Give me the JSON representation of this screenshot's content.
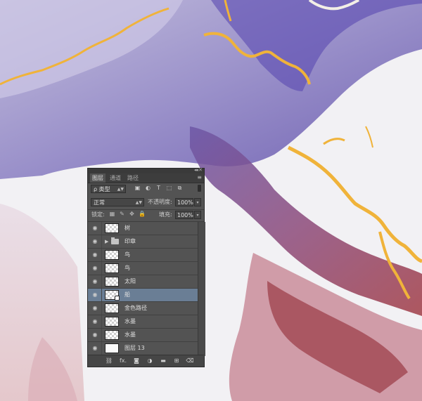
{
  "panel": {
    "tabs": [
      {
        "label": "图层",
        "active": true
      },
      {
        "label": "通道",
        "active": false
      },
      {
        "label": "路径",
        "active": false
      }
    ],
    "filter_kind": "ρ 类型",
    "blend_mode": "正常",
    "opacity_label": "不透明度:",
    "opacity_value": "100%",
    "lock_label": "锁定:",
    "fill_label": "填充:",
    "fill_value": "100%",
    "layers": [
      {
        "name": "树",
        "type": "raster",
        "visible": true,
        "selected": false
      },
      {
        "name": "印章",
        "type": "group",
        "visible": true,
        "selected": false
      },
      {
        "name": "鸟",
        "type": "raster",
        "visible": true,
        "selected": false
      },
      {
        "name": "鸟",
        "type": "raster",
        "visible": true,
        "selected": false
      },
      {
        "name": "太阳",
        "type": "raster",
        "visible": true,
        "selected": false
      },
      {
        "name": "船",
        "type": "smart-object",
        "visible": true,
        "selected": true
      },
      {
        "name": "金色路径",
        "type": "raster",
        "visible": true,
        "selected": false
      },
      {
        "name": "水墨",
        "type": "raster",
        "visible": true,
        "selected": false
      },
      {
        "name": "水墨",
        "type": "raster",
        "visible": true,
        "selected": false
      },
      {
        "name": "图层 13",
        "type": "raster-white",
        "visible": true,
        "selected": false
      }
    ],
    "bottom_icons": [
      "link-icon",
      "fx-icon",
      "mask-icon",
      "adjustment-icon",
      "folder-icon",
      "new-layer-icon",
      "trash-icon"
    ],
    "fx_label": "fx."
  },
  "colors": {
    "selected_row": "#6a7e95",
    "panel_bg": "#535353",
    "gold": "#f0b33a",
    "ink_purple": "#4a3f9a",
    "ink_red": "#9a3b45"
  }
}
